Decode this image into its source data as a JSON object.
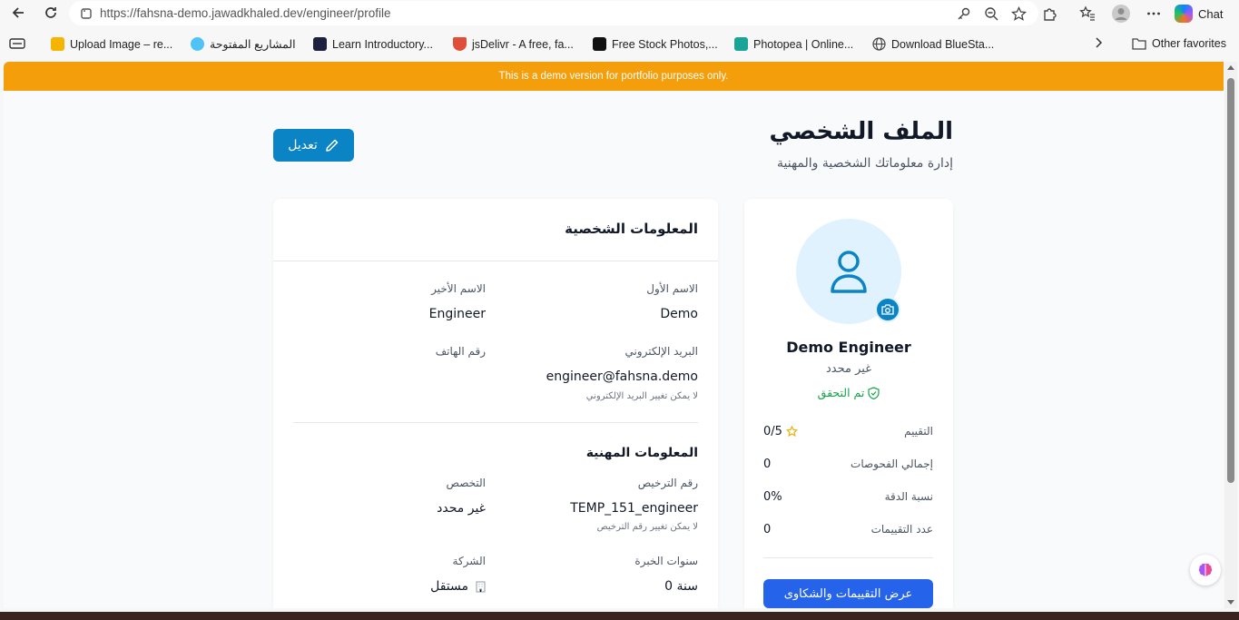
{
  "browser": {
    "url": "https://fahsna-demo.jawadkhaled.dev/engineer/profile",
    "chat_label": "Chat"
  },
  "favorites": {
    "items": [
      {
        "label": "Upload Image – re...",
        "color": "#f4b400"
      },
      {
        "label": "المشاريع المفتوحة",
        "color": "#4fc3f7"
      },
      {
        "label": "Learn Introductory...",
        "color": "#1e1e3f"
      },
      {
        "label": "jsDelivr - A free, fa...",
        "color": "#e04e39"
      },
      {
        "label": "Free Stock Photos,...",
        "color": "#111111"
      },
      {
        "label": "Photopea | Online...",
        "color": "#18a497"
      },
      {
        "label": "Download BlueSta...",
        "color": "#555555"
      }
    ],
    "other": "Other favorites"
  },
  "banner": {
    "text": "This is a demo version for portfolio purposes only.",
    "color": "#f59e0b"
  },
  "header": {
    "title": "الملف الشخصي",
    "subtitle": "إدارة معلوماتك الشخصية والمهنية",
    "edit_label": "تعديل"
  },
  "profile": {
    "name": "Demo Engineer",
    "specialization": "غير محدد",
    "verified_label": "تم التحقق",
    "stats": [
      {
        "label": "التقييم",
        "value": "0/5"
      },
      {
        "label": "إجمالي الفحوصات",
        "value": "0"
      },
      {
        "label": "نسبة الدقة",
        "value": "0%"
      },
      {
        "label": "عدد التقييمات",
        "value": "0"
      }
    ],
    "reviews_button": "عرض التقييمات والشكاوى"
  },
  "personal_info": {
    "title": "المعلومات الشخصية",
    "first_name_label": "الاسم الأول",
    "first_name": "Demo",
    "last_name_label": "الاسم الأخير",
    "last_name": "Engineer",
    "email_label": "البريد الإلكتروني",
    "email": "engineer@fahsna.demo",
    "email_hint": "لا يمكن تغيير البريد الإلكتروني",
    "phone_label": "رقم الهاتف",
    "phone": ""
  },
  "professional_info": {
    "title": "المعلومات المهنية",
    "license_label": "رقم الترخيص",
    "license": "TEMP_151_engineer",
    "license_hint": "لا يمكن تغيير رقم الترخيص",
    "specialization_label": "التخصص",
    "specialization": "غير محدد",
    "experience_label": "سنوات الخبرة",
    "experience": "0 سنة",
    "company_label": "الشركة",
    "company": "مستقل"
  },
  "colors": {
    "primary": "#0b84c6",
    "button_blue": "#2563eb",
    "verified_green": "#16a34a",
    "star": "#eab308"
  }
}
